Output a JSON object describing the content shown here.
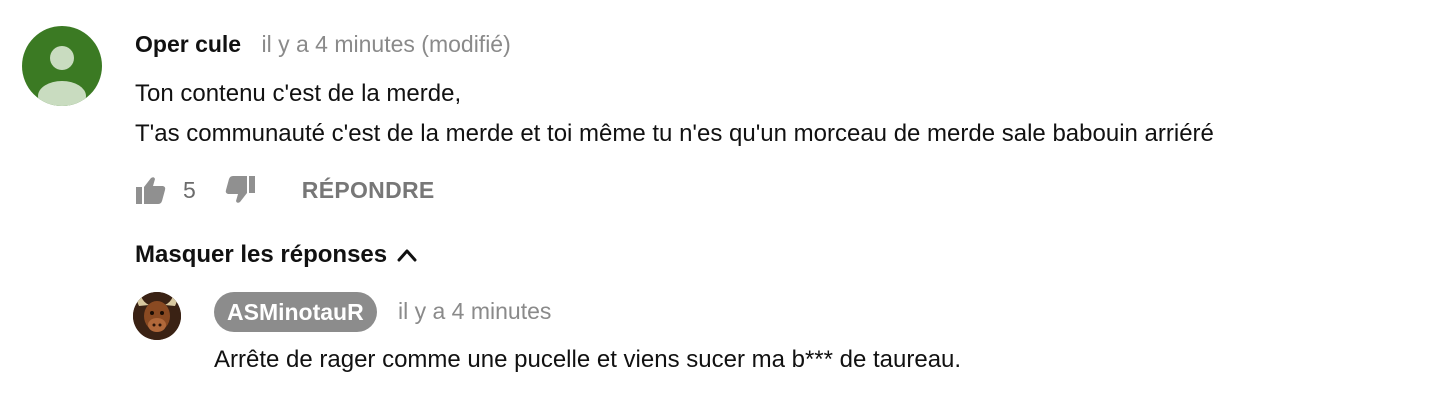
{
  "comment": {
    "author": "Oper cule",
    "timestamp": "il y a 4 minutes (modifié)",
    "text": "Ton contenu c'est de la merde,\nT'as communauté c'est de la merde et toi même tu n'es qu'un morceau de merde sale babouin arriéré",
    "like_count": "5",
    "reply_label": "RÉPONDRE",
    "avatar_color": "#3b7a23",
    "icons": [
      "like-icon",
      "dislike-icon"
    ]
  },
  "replies_toggle": {
    "label": "Masquer les réponses",
    "icon": "chevron-up-icon"
  },
  "reply": {
    "author": "ASMinotauR",
    "timestamp": "il y a 4 minutes",
    "text": "Arrête de rager comme une pucelle et viens sucer ma b*** de taureau.",
    "author_badge_color": "#8c8c8c"
  }
}
